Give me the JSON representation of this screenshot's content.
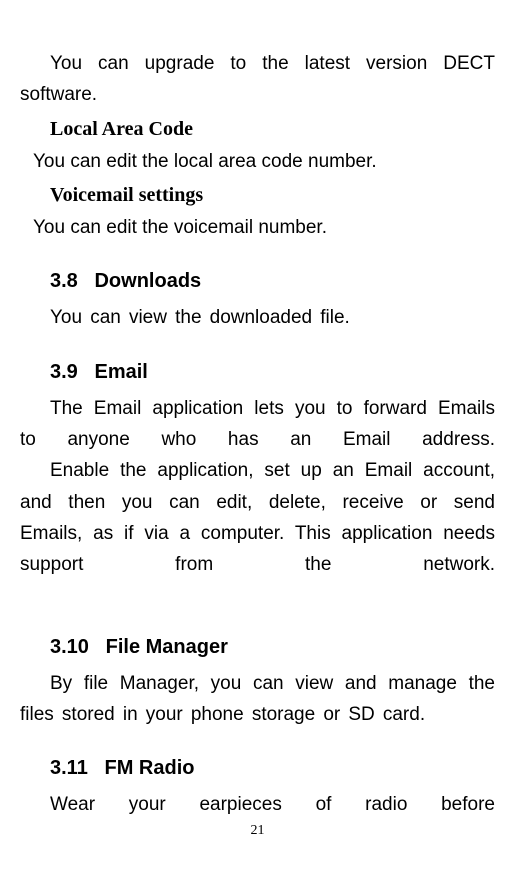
{
  "intro": {
    "p1": "You can upgrade to the latest version DECT software."
  },
  "localAreaCode": {
    "heading": "Local Area Code",
    "body": "You can edit the local area code number."
  },
  "voicemail": {
    "heading": "Voicemail settings",
    "body": "You can edit the voicemail number."
  },
  "sections": {
    "downloads": {
      "number": "3.8",
      "title": "Downloads",
      "body": "You can view the downloaded file."
    },
    "email": {
      "number": "3.9",
      "title": "Email",
      "p1": "The Email application lets you to forward Emails to anyone who has an Email address.",
      "p2": "Enable the application, set up an Email account, and then you can edit, delete, receive or send Emails, as if via a computer. This application needs support from the network."
    },
    "fileManager": {
      "number": "3.10",
      "title": "File Manager",
      "body": "By file Manager, you can view and manage the files stored in your phone storage or SD card."
    },
    "fmRadio": {
      "number": "3.11",
      "title": "FM Radio",
      "body": "Wear  your earpieces  of radio before"
    }
  },
  "pageNumber": "21"
}
